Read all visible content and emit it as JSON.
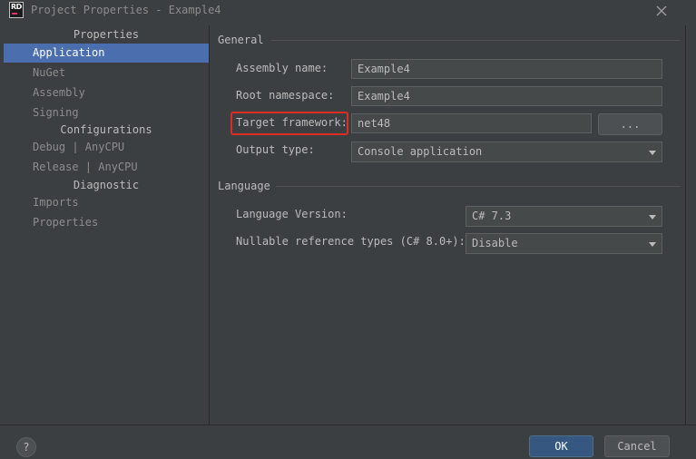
{
  "window": {
    "title": "Project Properties - Example4",
    "logo_text": "RD"
  },
  "sidebar": {
    "headers": [
      "Properties",
      "Configurations",
      "Diagnostic"
    ],
    "items": [
      {
        "label": "Application",
        "selected": true
      },
      {
        "label": "NuGet"
      },
      {
        "label": "Assembly"
      },
      {
        "label": "Signing"
      },
      {
        "label": "Debug | AnyCPU"
      },
      {
        "label": "Release | AnyCPU"
      },
      {
        "label": "Imports"
      },
      {
        "label": "Properties"
      }
    ]
  },
  "general": {
    "title": "General",
    "assembly_name_label": "Assembly name:",
    "assembly_name_value": "Example4",
    "root_namespace_label": "Root namespace:",
    "root_namespace_value": "Example4",
    "target_framework_label": "Target framework:",
    "target_framework_value": "net48",
    "browse_label": "...",
    "output_type_label": "Output type:",
    "output_type_value": "Console application"
  },
  "language": {
    "title": "Language",
    "language_version_label": "Language Version:",
    "language_version_value": "C# 7.3",
    "nullable_label": "Nullable reference types (C# 8.0+):",
    "nullable_value": "Disable"
  },
  "footer": {
    "help_label": "?",
    "ok_label": "OK",
    "cancel_label": "Cancel"
  },
  "colors": {
    "background": "#3c3f41",
    "selection": "#4b6eaf",
    "primary_button": "#365880",
    "highlight": "#e02b20"
  }
}
